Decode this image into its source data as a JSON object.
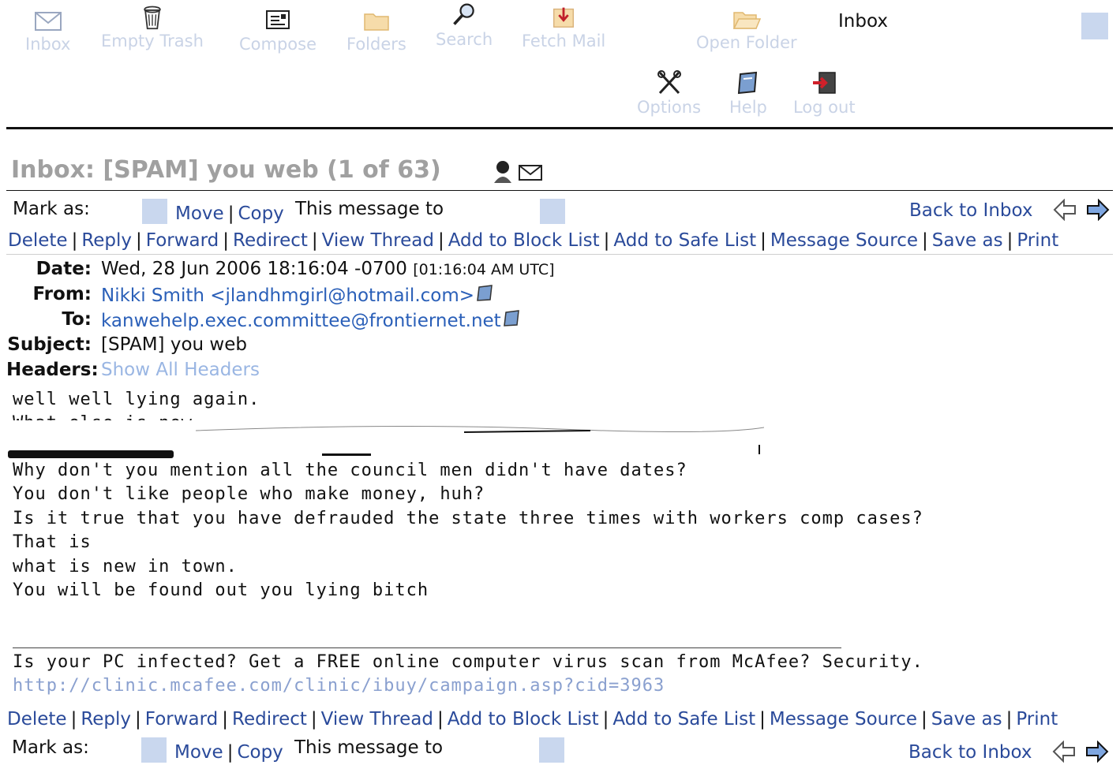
{
  "toolbar": {
    "buttons": [
      {
        "label": "Inbox",
        "icon": "envelope-icon"
      },
      {
        "label": "Empty Trash",
        "icon": "trash-icon"
      },
      {
        "label": "Compose",
        "icon": "compose-icon"
      },
      {
        "label": "Folders",
        "icon": "folder-icon"
      },
      {
        "label": "Search",
        "icon": "magnifier-icon"
      },
      {
        "label": "Fetch Mail",
        "icon": "fetch-mail-icon"
      },
      {
        "label": "Open Folder",
        "icon": "open-folder-icon"
      },
      {
        "label": "Options",
        "icon": "tools-icon"
      },
      {
        "label": "Help",
        "icon": "help-book-icon"
      },
      {
        "label": "Log out",
        "icon": "logout-icon"
      }
    ],
    "current_folder": "Inbox"
  },
  "message": {
    "heading": "Inbox: [SPAM] you web (1 of 63)",
    "date": "Wed, 28 Jun 2006 18:16:04 -0700",
    "date_utc": "[01:16:04 AM UTC]",
    "from": "Nikki Smith <jlandhmgirl@hotmail.com>",
    "to": "kanwehelp.exec.committee@frontiernet.net",
    "subject": "[SPAM] you web",
    "headers_link": "Show All Headers",
    "body_lines": [
      "well well lying again.",
      "What else is new",
      "Why don't you mention all the council men didn't have dates?",
      "You don't like people who make money, huh?",
      "Is it true that you have defrauded the state three times with workers comp cases?",
      "That is",
      "what is new in town.",
      "You will be found out you lying bitch"
    ],
    "footer_text": "Is your PC infected? Get a FREE online computer virus scan from McAfee? Security.",
    "footer_link": "http://clinic.mcafee.com/clinic/ibuy/campaign.asp?cid=3963"
  },
  "labels": {
    "mark_as": "Mark as:",
    "move": "Move",
    "copy": "Copy",
    "this_message_to": "This message to",
    "back_to_inbox": "Back to Inbox",
    "date": "Date:",
    "from": "From:",
    "to": "To:",
    "subject": "Subject:",
    "headers": "Headers:"
  },
  "actions": [
    "Delete",
    "Reply",
    "Forward",
    "Redirect",
    "View Thread",
    "Add to Block List",
    "Add to Safe List",
    "Message Source",
    "Save as",
    "Print"
  ]
}
